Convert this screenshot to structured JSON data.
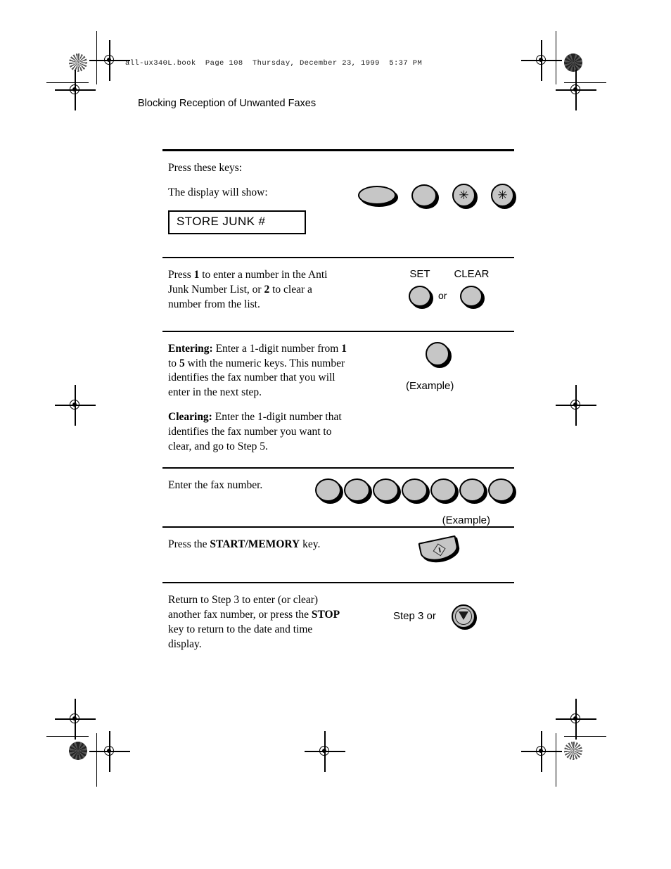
{
  "header": {
    "book_line": "all-ux340L.book  Page 108  Thursday, December 23, 1999  5:37 PM",
    "section_title": "Blocking Reception of Unwanted Faxes"
  },
  "steps": [
    {
      "id": "step-press-keys",
      "lines": [
        {
          "text": "Press these keys:"
        },
        {
          "text": "The display will show:"
        }
      ],
      "display_value": "STORE JUNK #",
      "keys": [
        {
          "name": "function-key",
          "shape": "oval",
          "glyph": ""
        },
        {
          "name": "numeric-key",
          "shape": "round",
          "glyph": ""
        },
        {
          "name": "star-key",
          "shape": "circle",
          "glyph": "✳"
        },
        {
          "name": "star-key",
          "shape": "circle",
          "glyph": "✳"
        }
      ]
    },
    {
      "id": "step-choose-enter-or-clear",
      "text_runs": [
        {
          "t": " Press ",
          "b": false
        },
        {
          "t": "1",
          "b": true
        },
        {
          "t": " to enter a number in the Anti Junk Number List, or ",
          "b": false
        },
        {
          "t": "2",
          "b": true
        },
        {
          "t": " to clear a number from the list.",
          "b": false
        }
      ],
      "set_label": "SET",
      "clear_label": "CLEAR",
      "or_label": "or"
    },
    {
      "id": "step-entering-clearing",
      "entering_label": "Entering:",
      "entering_runs": [
        {
          "t": " Enter a 1-digit number from ",
          "b": false
        },
        {
          "t": "1",
          "b": true
        },
        {
          "t": " to ",
          "b": false
        },
        {
          "t": "5",
          "b": true
        },
        {
          "t": " with the numeric keys. This number identifies the fax number that you will enter in the next step.",
          "b": false
        }
      ],
      "clearing_label": "Clearing:",
      "clearing_text": " Enter the 1-digit number that identifies the fax number you want to clear, and go to Step 5.",
      "example_caption": "(Example)"
    },
    {
      "id": "step-enter-fax-number",
      "text": "Enter the fax number.",
      "key_count": 7,
      "example_caption": "(Example)"
    },
    {
      "id": "step-press-start-memory",
      "text_runs": [
        {
          "t": "Press the ",
          "b": false
        },
        {
          "t": "START/MEMORY",
          "b": true
        },
        {
          "t": " key.",
          "b": false
        }
      ],
      "key_name": "start-memory-key"
    },
    {
      "id": "step-return-or-stop",
      "text_runs": [
        {
          "t": "Return to Step 3 to enter (or clear) another fax number, or press the ",
          "b": false
        },
        {
          "t": "STOP",
          "b": true
        },
        {
          "t": " key to return to the date and time display.",
          "b": false
        }
      ],
      "step_label": "Step 3 or",
      "key_name": "stop-key"
    }
  ],
  "colors": {
    "key_fill": "#c6c6c6",
    "key_outline": "#000000",
    "rule": "#000000"
  }
}
